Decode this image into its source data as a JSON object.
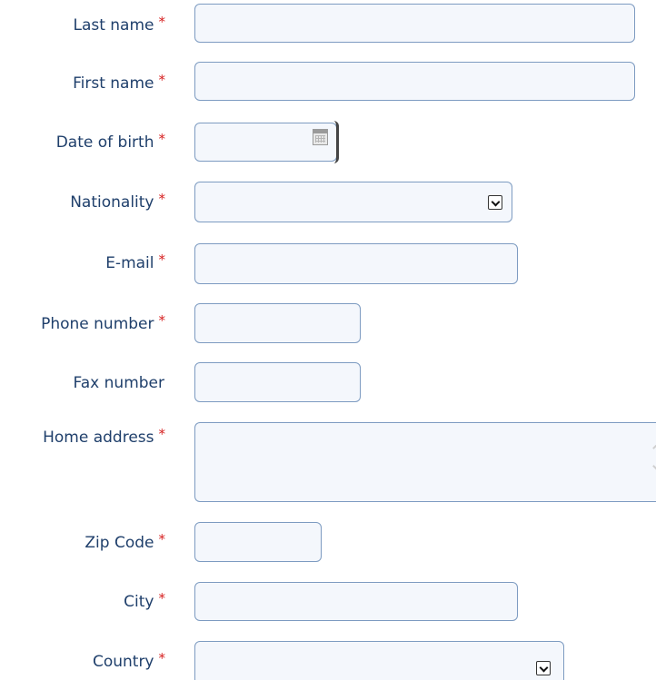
{
  "required_marker": "*",
  "fields": {
    "last_name": {
      "label": "Last name",
      "value": ""
    },
    "first_name": {
      "label": "First name",
      "value": ""
    },
    "date_of_birth": {
      "label": "Date of birth",
      "value": ""
    },
    "nationality": {
      "label": "Nationality",
      "selected": ""
    },
    "email": {
      "label": "E-mail",
      "value": ""
    },
    "phone_number": {
      "label": "Phone number",
      "value": ""
    },
    "fax_number": {
      "label": "Fax number",
      "value": ""
    },
    "home_address": {
      "label": "Home address",
      "value": ""
    },
    "zip_code": {
      "label": "Zip Code",
      "value": ""
    },
    "city": {
      "label": "City",
      "value": ""
    },
    "country": {
      "label": "Country",
      "selected": ""
    }
  },
  "icons": {
    "calendar": "calendar-icon",
    "dropdown": "chevron-down-icon",
    "scroll": "scroll-arrows-icon"
  },
  "colors": {
    "label_text": "#1f3f6b",
    "required_marker": "#d62020",
    "field_border": "#7d9bc1",
    "field_background": "#f4f7fc"
  }
}
